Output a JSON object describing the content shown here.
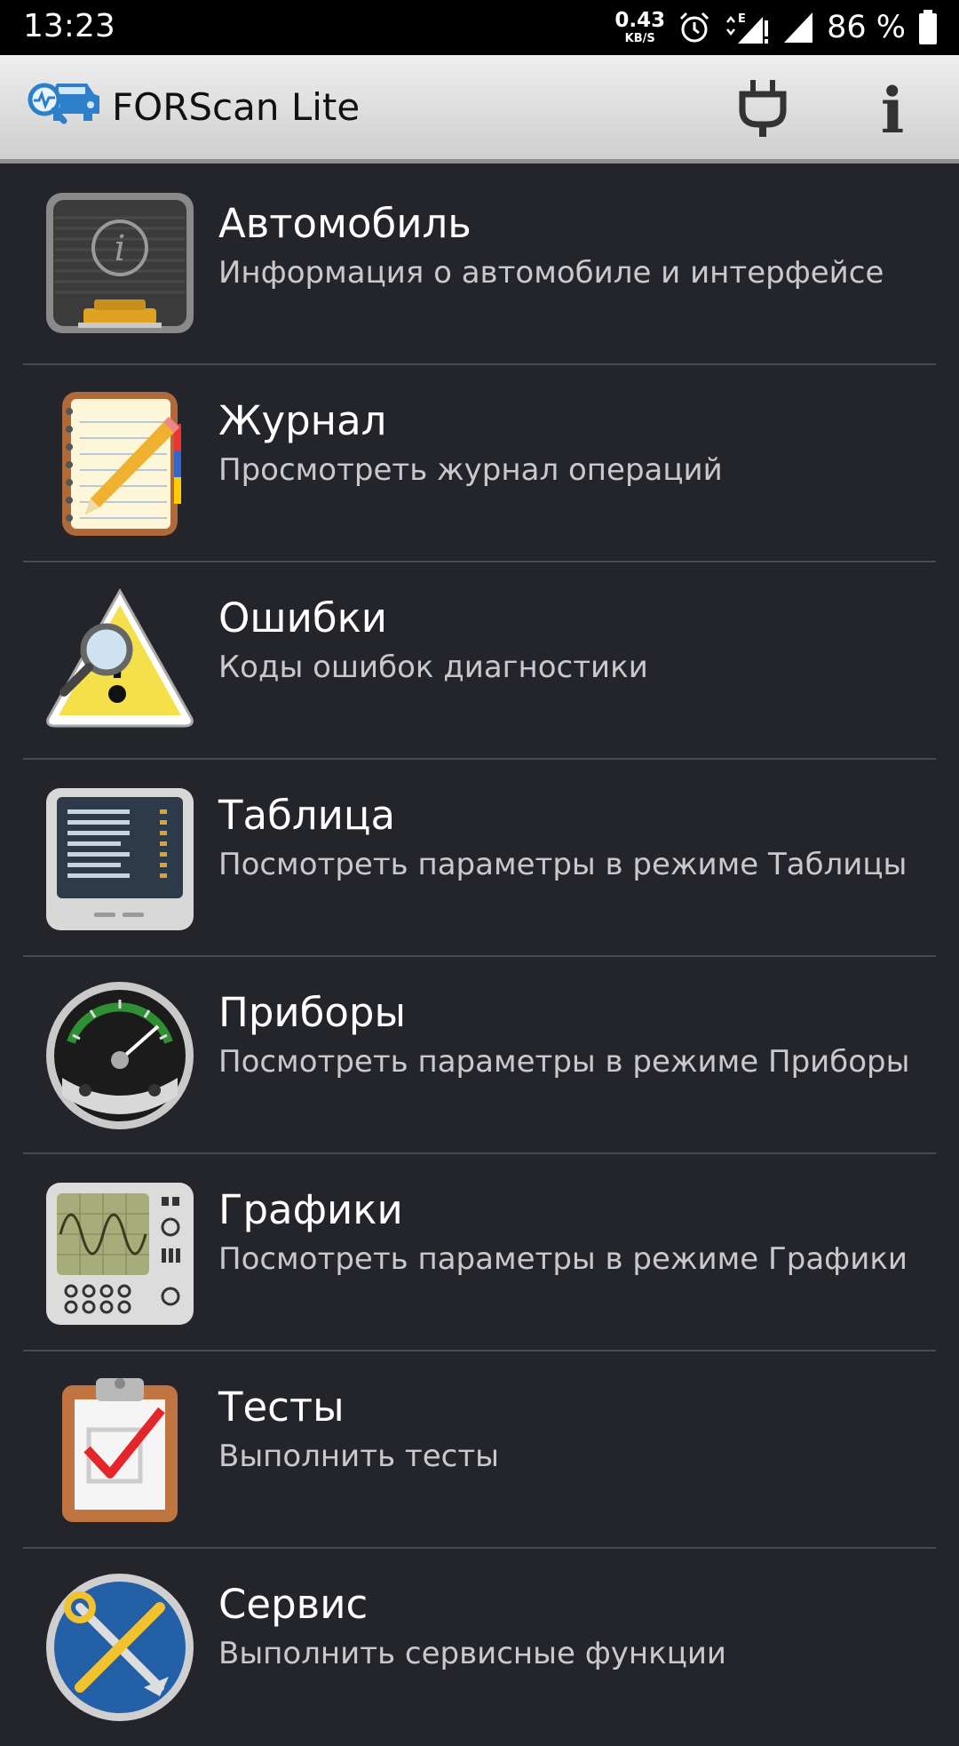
{
  "status_bar": {
    "time": "13:23",
    "net_speed_value": "0.43",
    "net_speed_unit": "KB/S",
    "network_type": "E",
    "battery": "86 %"
  },
  "app_bar": {
    "title": "FORScan Lite",
    "logo_icon": "car-diagnostics-icon",
    "actions": [
      {
        "icon": "plug-icon"
      },
      {
        "icon": "info-icon",
        "glyph": "i"
      }
    ]
  },
  "menu": {
    "items": [
      {
        "title": "Автомобиль",
        "subtitle": "Информация о автомобиле и интерфейсе",
        "icon": "vehicle-info-icon"
      },
      {
        "title": "Журнал",
        "subtitle": "Просмотреть журнал операций",
        "icon": "notepad-pencil-icon"
      },
      {
        "title": "Ошибки",
        "subtitle": "Коды ошибок диагностики",
        "icon": "warning-magnifier-icon"
      },
      {
        "title": "Таблица",
        "subtitle": "Посмотреть параметры в режиме Таблицы",
        "icon": "table-monitor-icon"
      },
      {
        "title": "Приборы",
        "subtitle": "Посмотреть параметры в режиме Приборы",
        "icon": "gauge-icon"
      },
      {
        "title": "Графики",
        "subtitle": "Посмотреть параметры в режиме Графики",
        "icon": "oscilloscope-icon"
      },
      {
        "title": "Тесты",
        "subtitle": "Выполнить тесты",
        "icon": "clipboard-check-icon"
      },
      {
        "title": "Сервис",
        "subtitle": "Выполнить сервисные функции",
        "icon": "service-tools-icon"
      }
    ]
  }
}
